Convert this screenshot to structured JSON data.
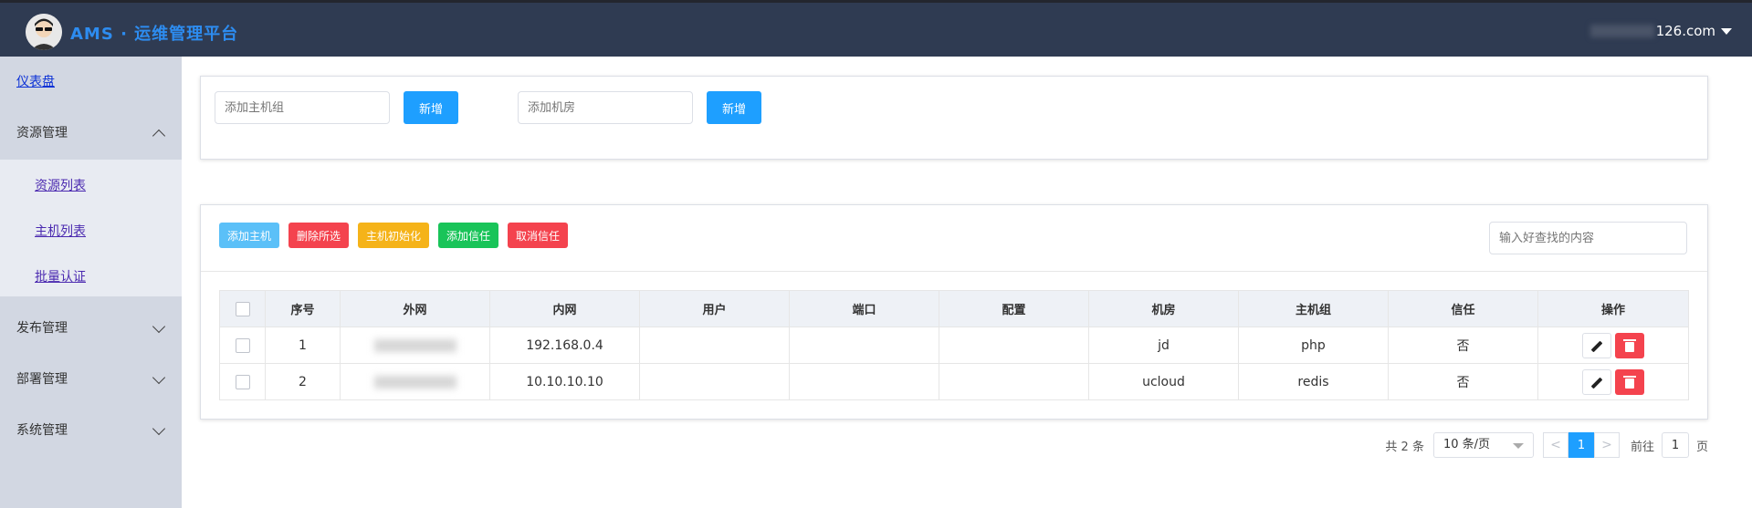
{
  "header": {
    "app_title": "AMS · 运维管理平台",
    "user_suffix": "126.com"
  },
  "sidebar": {
    "dashboard": "仪表盘",
    "groups": [
      {
        "label": "资源管理",
        "expanded": true,
        "items": [
          "资源列表",
          "主机列表",
          "批量认证"
        ]
      },
      {
        "label": "发布管理",
        "expanded": false
      },
      {
        "label": "部署管理",
        "expanded": false
      },
      {
        "label": "系统管理",
        "expanded": false
      }
    ]
  },
  "top_panel": {
    "host_group_placeholder": "添加主机组",
    "host_group_button": "新增",
    "room_placeholder": "添加机房",
    "room_button": "新增"
  },
  "toolbar": {
    "add_host": "添加主机",
    "delete_selected": "删除所选",
    "host_init": "主机初始化",
    "add_trust": "添加信任",
    "cancel_trust": "取消信任",
    "search_placeholder": "输入好查找的内容"
  },
  "table": {
    "columns": [
      "",
      "序号",
      "外网",
      "内网",
      "用户",
      "端口",
      "配置",
      "机房",
      "主机组",
      "信任",
      "操作"
    ],
    "rows": [
      {
        "index": "1",
        "internal_ip": "192.168.0.4",
        "user": "",
        "port": "",
        "config": "",
        "room": "jd",
        "group": "php",
        "trust": "否"
      },
      {
        "index": "2",
        "internal_ip": "10.10.10.10",
        "user": "",
        "port": "",
        "config": "",
        "room": "ucloud",
        "group": "redis",
        "trust": "否"
      }
    ]
  },
  "pagination": {
    "total": "共 2 条",
    "page_size": "10 条/页",
    "prev": "<",
    "current": "1",
    "next": ">",
    "goto_label": "前往",
    "goto_value": "1",
    "page_unit": "页"
  },
  "colors": {
    "header_bg": "#2f3b52",
    "brand": "#2d8cf0",
    "primary": "#1e9fff",
    "danger": "#f4434e",
    "warning": "#f5b319",
    "success": "#19c459",
    "info": "#5bc0f8"
  }
}
